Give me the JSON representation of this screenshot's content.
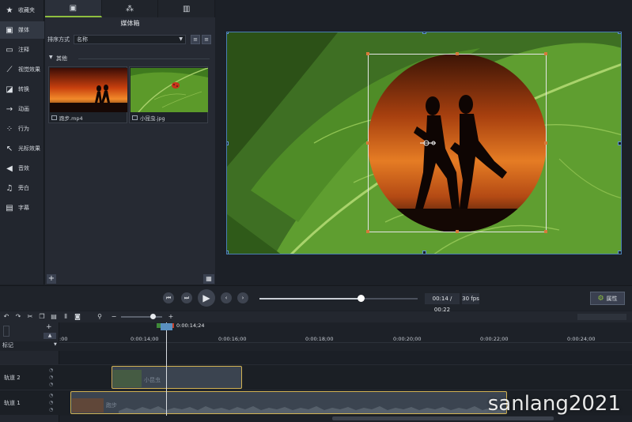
{
  "nav": {
    "items": [
      {
        "label": "收藏夹",
        "icon": "star-icon"
      },
      {
        "label": "媒体",
        "icon": "film-icon"
      },
      {
        "label": "注释",
        "icon": "annotation-icon"
      },
      {
        "label": "视觉效果",
        "icon": "magic-wand-icon"
      },
      {
        "label": "转换",
        "icon": "transition-icon"
      },
      {
        "label": "动画",
        "icon": "animation-icon"
      },
      {
        "label": "行为",
        "icon": "behavior-icon"
      },
      {
        "label": "光标效果",
        "icon": "cursor-icon"
      },
      {
        "label": "音效",
        "icon": "speaker-icon"
      },
      {
        "label": "旁白",
        "icon": "microphone-icon"
      },
      {
        "label": "字幕",
        "icon": "caption-icon"
      }
    ]
  },
  "panel": {
    "title": "媒体箱",
    "sort_label": "排序方式",
    "sort_value": "名称",
    "group_label": "其他",
    "media": [
      {
        "name": "跑步.mp4"
      },
      {
        "name": "小昆虫.jpg"
      }
    ]
  },
  "player": {
    "time": "00:14 / 00:22",
    "fps": "30 fps",
    "props_label": "属性",
    "progress": 0.64
  },
  "timeline": {
    "playhead_time": "0:00:14;24",
    "marker_label": "标记",
    "ticks": [
      ":00",
      "0:00:14;00",
      "0:00:16;00",
      "0:00:18;00",
      "0:00:20;00",
      "0:00:22;00",
      "0:00:24;00"
    ],
    "tracks": [
      {
        "label": "轨道 2",
        "clip": "小昆虫"
      },
      {
        "label": "轨道 1",
        "clip": "跑步"
      }
    ]
  },
  "watermark": "sanlang2021"
}
